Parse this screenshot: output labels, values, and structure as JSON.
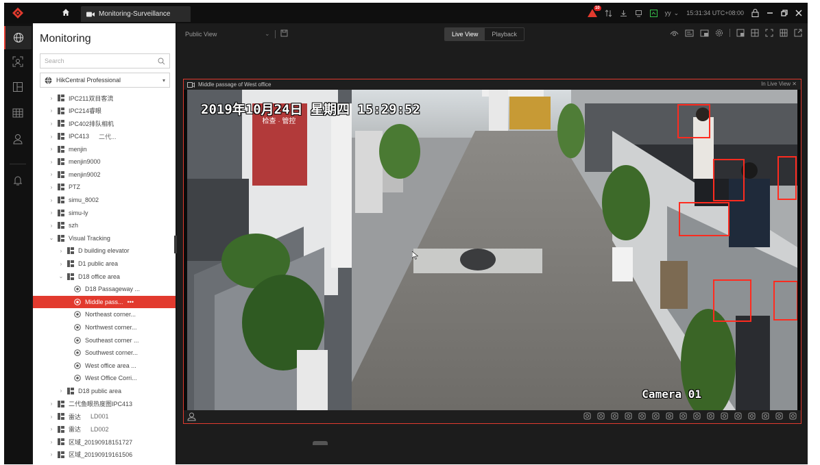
{
  "app": {
    "tab_title": "Monitoring-Surveillance",
    "alarm_count": "10",
    "user": "yy",
    "time": "15:31:34 UTC+08:00"
  },
  "rail": {
    "items": [
      {
        "icon": "globe-icon",
        "active": true
      },
      {
        "icon": "face-recognition-icon",
        "active": false
      },
      {
        "icon": "layout-icon",
        "active": false
      },
      {
        "icon": "grid-icon",
        "active": false
      },
      {
        "icon": "person-icon",
        "active": false
      },
      {
        "icon": "alarm-bell-icon",
        "active": false
      }
    ]
  },
  "panel": {
    "title": "Monitoring",
    "search_placeholder": "Search",
    "site_name": "HikCentral Professional"
  },
  "tree": [
    {
      "label": "IPC211双目客流",
      "level": 1,
      "type": "folder",
      "expanded": false
    },
    {
      "label": "IPC214睿眼",
      "level": 1,
      "type": "folder",
      "expanded": false
    },
    {
      "label": "IPC402排队相机",
      "level": 1,
      "type": "folder",
      "expanded": false
    },
    {
      "label": "IPC413",
      "extra": "二代...",
      "level": 1,
      "type": "folder",
      "expanded": false
    },
    {
      "label": "menjin",
      "level": 1,
      "type": "folder",
      "expanded": false
    },
    {
      "label": "menjin9000",
      "level": 1,
      "type": "folder",
      "expanded": false
    },
    {
      "label": "menjin9002",
      "level": 1,
      "type": "folder",
      "expanded": false
    },
    {
      "label": "PTZ",
      "level": 1,
      "type": "folder",
      "expanded": false
    },
    {
      "label": "simu_8002",
      "level": 1,
      "type": "folder",
      "expanded": false
    },
    {
      "label": "simu-ly",
      "level": 1,
      "type": "folder",
      "expanded": false
    },
    {
      "label": "szh",
      "level": 1,
      "type": "folder",
      "expanded": false
    },
    {
      "label": "Visual Tracking",
      "level": 1,
      "type": "folder",
      "expanded": true
    },
    {
      "label": "D building elevator",
      "level": 2,
      "type": "folder",
      "expanded": false
    },
    {
      "label": "D1 public area",
      "level": 2,
      "type": "folder",
      "expanded": false
    },
    {
      "label": "D18 office area",
      "level": 2,
      "type": "folder",
      "expanded": true
    },
    {
      "label": "D18 Passageway ...",
      "level": 3,
      "type": "camera"
    },
    {
      "label": "Middle pass...",
      "level": 3,
      "type": "camera",
      "selected": true,
      "more": "•••"
    },
    {
      "label": "Northeast corner...",
      "level": 3,
      "type": "camera"
    },
    {
      "label": "Northwest corner...",
      "level": 3,
      "type": "camera"
    },
    {
      "label": "Southeast corner ...",
      "level": 3,
      "type": "camera"
    },
    {
      "label": "Southwest corner...",
      "level": 3,
      "type": "camera"
    },
    {
      "label": "West office area ...",
      "level": 3,
      "type": "camera"
    },
    {
      "label": "West Office Corri...",
      "level": 3,
      "type": "camera"
    },
    {
      "label": "D18 public area",
      "level": 2,
      "type": "folder",
      "expanded": false
    },
    {
      "label": "二代鱼眼热度图IPC413",
      "level": 1,
      "type": "folder",
      "expanded": false
    },
    {
      "label": "雷达",
      "extra": "LD001",
      "level": 1,
      "type": "folder",
      "expanded": false
    },
    {
      "label": "雷达",
      "extra": "LD002",
      "level": 1,
      "type": "folder",
      "expanded": false
    },
    {
      "label": "区域_20190918151727",
      "level": 1,
      "type": "folder",
      "expanded": false
    },
    {
      "label": "区域_20190919161506",
      "level": 1,
      "type": "folder",
      "expanded": false
    }
  ],
  "toolbar": {
    "view_name": "Public View",
    "live_view": "Live View",
    "playback": "Playback",
    "right_icons": [
      "capture-icon",
      "record-icon",
      "window-icon",
      "settings-icon",
      "divider",
      "layout-1-icon",
      "layout-4-icon",
      "fullscreen-icon",
      "layout-grid-icon",
      "popout-icon"
    ]
  },
  "video": {
    "title": "Middle passage of West office",
    "status": "In Live View",
    "osd_time": "2019年10月24日 星期四 15:29:52",
    "osd_camera": "Camera 01",
    "sign_text": "检查 · 管控",
    "toolbar_icons": [
      "snapshot-icon",
      "print-icon",
      "record-icon",
      "playback-icon",
      "mic-icon",
      "zoom-icon",
      "person-search-icon",
      "image-search-icon",
      "image-icon",
      "face-icon",
      "ptz-icon",
      "layout-icon",
      "alarm-icon",
      "audio-icon",
      "bookmark-icon",
      "more-icon"
    ]
  }
}
